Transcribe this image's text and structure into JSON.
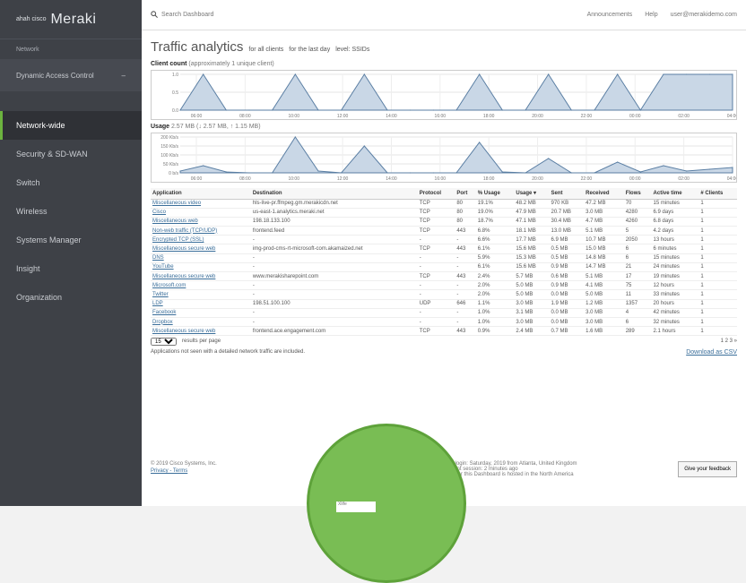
{
  "brand": {
    "cisco": "ahah cisco",
    "name": "Meraki"
  },
  "sidebar": {
    "top_item": "Network",
    "network_name": "Dynamic Access Control",
    "items": [
      {
        "label": "Network-wide",
        "active": true
      },
      {
        "label": "Security & SD-WAN",
        "active": false
      },
      {
        "label": "Switch",
        "active": false
      },
      {
        "label": "Wireless",
        "active": false
      },
      {
        "label": "Systems Manager",
        "active": false
      },
      {
        "label": "Insight",
        "active": false
      },
      {
        "label": "Organization",
        "active": false
      }
    ]
  },
  "topbar": {
    "search_placeholder": "Search Dashboard",
    "announcements": "Announcements",
    "help": "Help",
    "user": "user@merakidemo.com"
  },
  "page": {
    "title": "Traffic analytics",
    "filter_clients": "for all clients",
    "filter_time": "for the last day",
    "filter_level": "level: SSIDs"
  },
  "client_count": {
    "label": "Client count",
    "sublabel": "(approximately 1 unique client)",
    "y_ticks": [
      "1.0",
      "0.5",
      "0.0"
    ],
    "x_ticks": [
      "06:00",
      "08:00",
      "10:00",
      "12:00",
      "14:00",
      "16:00",
      "18:00",
      "20:00",
      "22:00",
      "00:00",
      "02:00",
      "04:00"
    ]
  },
  "usage": {
    "label": "Usage",
    "sublabel": "2.57 MB (↓ 2.57 MB, ↑ 1.15 MB)",
    "y_ticks": [
      "200 Kb/s",
      "150 Kb/s",
      "100 Kb/s",
      "50 Kb/s",
      "0 b/s"
    ],
    "x_ticks": [
      "06:00",
      "08:00",
      "10:00",
      "12:00",
      "14:00",
      "16:00",
      "18:00",
      "20:00",
      "22:00",
      "00:00",
      "02:00",
      "04:00"
    ]
  },
  "chart_data": [
    {
      "type": "area",
      "title": "Client count",
      "x": [
        "05:00",
        "06:00",
        "07:00",
        "08:00",
        "09:00",
        "10:00",
        "11:00",
        "12:00",
        "13:00",
        "14:00",
        "15:00",
        "16:00",
        "17:00",
        "18:00",
        "19:00",
        "20:00",
        "21:00",
        "22:00",
        "23:00",
        "00:00",
        "01:00",
        "02:00",
        "03:00",
        "04:00",
        "05:00"
      ],
      "series": [
        {
          "values": [
            0,
            1,
            0,
            0,
            0,
            1,
            0,
            0,
            1,
            0,
            0,
            0,
            0,
            1,
            0,
            0,
            1,
            0,
            0,
            1,
            0,
            1,
            1,
            1,
            1
          ]
        }
      ],
      "ylim": [
        0,
        1
      ]
    },
    {
      "type": "area",
      "title": "Usage",
      "x": [
        "05:00",
        "06:00",
        "07:00",
        "08:00",
        "09:00",
        "10:00",
        "11:00",
        "12:00",
        "13:00",
        "14:00",
        "15:00",
        "16:00",
        "17:00",
        "18:00",
        "19:00",
        "20:00",
        "21:00",
        "22:00",
        "23:00",
        "00:00",
        "01:00",
        "02:00",
        "03:00",
        "04:00",
        "05:00"
      ],
      "series": [
        {
          "values": [
            10,
            40,
            5,
            0,
            0,
            200,
            10,
            0,
            150,
            0,
            0,
            0,
            0,
            170,
            5,
            0,
            80,
            0,
            0,
            60,
            5,
            40,
            10,
            20,
            30
          ]
        }
      ],
      "ylabel": "Kb/s",
      "ylim": [
        0,
        200
      ]
    }
  ],
  "table": {
    "headers": [
      "Application",
      "Destination",
      "Protocol",
      "Port",
      "% Usage",
      "Usage ▾",
      "Sent",
      "Received",
      "Flows",
      "Active time",
      "# Clients"
    ],
    "rows": [
      [
        "Miscellaneous video",
        "hls-live-pr.ffmpeg.gm.merakicdn.net",
        "TCP",
        "80",
        "19.1%",
        "48.2 MB",
        "970 KB",
        "47.2 MB",
        "70",
        "15 minutes",
        "1"
      ],
      [
        "Cisco",
        "us-east-1.analytics.meraki.net",
        "TCP",
        "80",
        "19.0%",
        "47.9 MB",
        "20.7 MB",
        "3.0 MB",
        "4280",
        "6.9 days",
        "1"
      ],
      [
        "Miscellaneous web",
        "198.18.133.100",
        "TCP",
        "80",
        "18.7%",
        "47.1 MB",
        "30.4 MB",
        "4.7 MB",
        "4260",
        "6.8 days",
        "1"
      ],
      [
        "Non-web traffic (TCP/UDP)",
        "frontend.feed",
        "TCP",
        "443",
        "6.8%",
        "18.1 MB",
        "13.0 MB",
        "5.1 MB",
        "5",
        "4.2 days",
        "1"
      ],
      [
        "Encrypted TCP (SSL)",
        "-",
        "-",
        "-",
        "6.6%",
        "17.7 MB",
        "6.9 MB",
        "10.7 MB",
        "2050",
        "13 hours",
        "1"
      ],
      [
        "Miscellaneous secure web",
        "img-prod-cms-rt-microsoft-com.akamaized.net",
        "TCP",
        "443",
        "6.1%",
        "15.6 MB",
        "0.5 MB",
        "15.0 MB",
        "6",
        "6 minutes",
        "1"
      ],
      [
        "DNS",
        "-",
        "-",
        "-",
        "5.9%",
        "15.3 MB",
        "0.5 MB",
        "14.8 MB",
        "6",
        "15 minutes",
        "1"
      ],
      [
        "YouTube",
        "-",
        "-",
        "-",
        "6.1%",
        "15.6 MB",
        "0.9 MB",
        "14.7 MB",
        "21",
        "24 minutes",
        "1"
      ],
      [
        "Miscellaneous secure web",
        "www.merakisharepoint.com",
        "TCP",
        "443",
        "2.4%",
        "5.7 MB",
        "0.6 MB",
        "5.1 MB",
        "17",
        "19 minutes",
        "1"
      ],
      [
        "Microsoft.com",
        "-",
        "-",
        "-",
        "2.0%",
        "5.0 MB",
        "0.9 MB",
        "4.1 MB",
        "75",
        "12 hours",
        "1"
      ],
      [
        "Twitter",
        "-",
        "-",
        "-",
        "2.0%",
        "5.0 MB",
        "0.0 MB",
        "5.0 MB",
        "11",
        "33 minutes",
        "1"
      ],
      [
        "LDP",
        "198.51.100.100",
        "UDP",
        "646",
        "1.1%",
        "3.0 MB",
        "1.9 MB",
        "1.2 MB",
        "1357",
        "20 hours",
        "1"
      ],
      [
        "Facebook",
        "-",
        "-",
        "-",
        "1.0%",
        "3.1 MB",
        "0.0 MB",
        "3.0 MB",
        "4",
        "42 minutes",
        "1"
      ],
      [
        "Dropbox",
        "-",
        "-",
        "-",
        "1.0%",
        "3.0 MB",
        "0.0 MB",
        "3.0 MB",
        "6",
        "32 minutes",
        "1"
      ],
      [
        "Miscellaneous secure web",
        "frontend.ace.engagement.com",
        "TCP",
        "443",
        "0.9%",
        "2.4 MB",
        "0.7 MB",
        "1.6 MB",
        "289",
        "2.1 hours",
        "1"
      ]
    ]
  },
  "pager": {
    "per_page": "15",
    "per_page_label": "results per page",
    "page_info": "1 2 3 »"
  },
  "note": "Applications not seen with a detailed network traffic are included.",
  "download_csv": "Download as CSV",
  "footer": {
    "copyright": "© 2019 Cisco Systems, Inc.",
    "privacy": "Privacy - Terms",
    "address_line1": "Last login: Saturday, 2019 from Atlanta, United Kingdom",
    "address_line2": "Current session: 2 minutes ago",
    "address_line3": "Data for this Dashboard is hosted in the North America",
    "feedback_button": "Give your feedback"
  },
  "overlay": {
    "inner_text": "Xlife"
  }
}
